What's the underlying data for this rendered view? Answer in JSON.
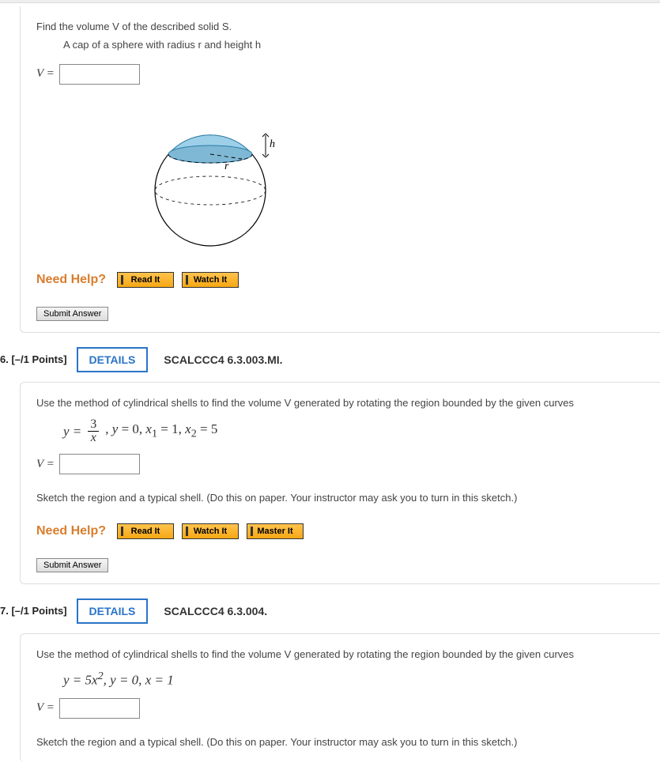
{
  "q5": {
    "prompt_main": "Find the volume V of the described solid S.",
    "prompt_sub": "A cap of a sphere with radius r and height h",
    "var_label": "V =",
    "diagram": {
      "h_label": "h",
      "r_label": "r"
    },
    "need_help": "Need Help?",
    "read_it": "Read It",
    "watch_it": "Watch It",
    "submit": "Submit Answer"
  },
  "q6": {
    "header_num": "6.",
    "header_points": "[–/1 Points]",
    "details": "DETAILS",
    "scalc": "SCALCCC4 6.3.003.MI.",
    "prompt_main": "Use the method of cylindrical shells to find the volume V generated by rotating the region bounded by the given curves ",
    "equation_parts": {
      "y_eq": "y =",
      "frac_num": "3",
      "frac_den": "x",
      "rest": ", y = 0, x₁ = 1, x₂ = 5"
    },
    "var_label": "V =",
    "sketch": "Sketch the region and a typical shell. (Do this on paper. Your instructor may ask you to turn in this sketch.)",
    "need_help": "Need Help?",
    "read_it": "Read It",
    "watch_it": "Watch It",
    "master_it": "Master It",
    "submit": "Submit Answer"
  },
  "q7": {
    "header_num": "7.",
    "header_points": "[–/1 Points]",
    "details": "DETAILS",
    "scalc": "SCALCCC4 6.3.004.",
    "prompt_main": "Use the method of cylindrical shells to find the volume V generated by rotating the region bounded by the given curves ",
    "equation": "y = 5x², y = 0, x = 1",
    "var_label": "V =",
    "sketch": "Sketch the region and a typical shell. (Do this on paper. Your instructor may ask you to turn in this sketch.)"
  }
}
